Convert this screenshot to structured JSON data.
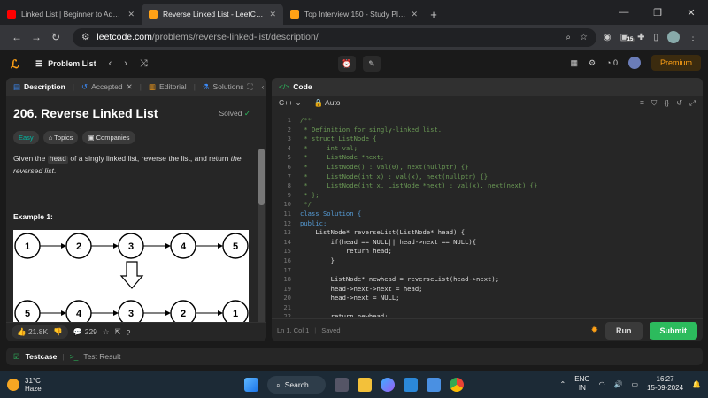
{
  "browser": {
    "tabs": [
      {
        "title": "Linked List | Beginner to Advanced",
        "fav_color": "#ff0000",
        "active": false
      },
      {
        "title": "Reverse Linked List - LeetCode",
        "fav_color": "#ffa116",
        "active": true
      },
      {
        "title": "Top Interview 150 - Study Plan - Le",
        "fav_color": "#ffa116",
        "active": false
      }
    ],
    "url_host": "leetcode.com",
    "url_path": "/problems/reverse-linked-list/description/",
    "badge_count": "15"
  },
  "topbar": {
    "problem_list": "Problem List",
    "coins": "0",
    "premium": "Premium"
  },
  "left_panel": {
    "tabs": [
      "Description",
      "Accepted",
      "Editorial",
      "Solutions"
    ],
    "title": "206. Reverse Linked List",
    "status": "Solved",
    "chips": [
      "Easy",
      "Topics",
      "Companies"
    ],
    "text_before": "Given the ",
    "code_word": "head",
    "text_after": " of a singly linked list, reverse the list, and return ",
    "text_italic": "the reversed list",
    "text_end": ".",
    "example_heading": "Example 1:",
    "diagram": {
      "top_nodes": [
        "1",
        "2",
        "3",
        "4",
        "5"
      ],
      "bottom_nodes": [
        "5",
        "4",
        "3",
        "2",
        "1"
      ]
    },
    "likes": "21.8K",
    "comments": "229"
  },
  "code_panel": {
    "title": "Code",
    "language": "C++",
    "mode": "Auto",
    "lines": [
      "/**",
      " * Definition for singly-linked list.",
      " * struct ListNode {",
      " *     int val;",
      " *     ListNode *next;",
      " *     ListNode() : val(0), next(nullptr) {}",
      " *     ListNode(int x) : val(x), next(nullptr) {}",
      " *     ListNode(int x, ListNode *next) : val(x), next(next) {}",
      " * };",
      " */",
      "class Solution {",
      "public:",
      "    ListNode* reverseList(ListNode* head) {",
      "        if(head == NULL|| head->next == NULL){",
      "            return head;",
      "        }",
      "",
      "        ListNode* newhead = reverseList(head->next);",
      "        head->next->next = head;",
      "        head->next = NULL;",
      "",
      "        return newhead;"
    ],
    "cursor": "Ln 1, Col 1",
    "saved": "Saved",
    "run_label": "Run",
    "submit_label": "Submit"
  },
  "bottom": {
    "testcase": "Testcase",
    "test_result": "Test Result"
  },
  "taskbar": {
    "temp": "31°C",
    "weather": "Haze",
    "search": "Search",
    "lang1": "ENG",
    "lang2": "IN",
    "time": "16:27",
    "date": "15-09-2024"
  }
}
